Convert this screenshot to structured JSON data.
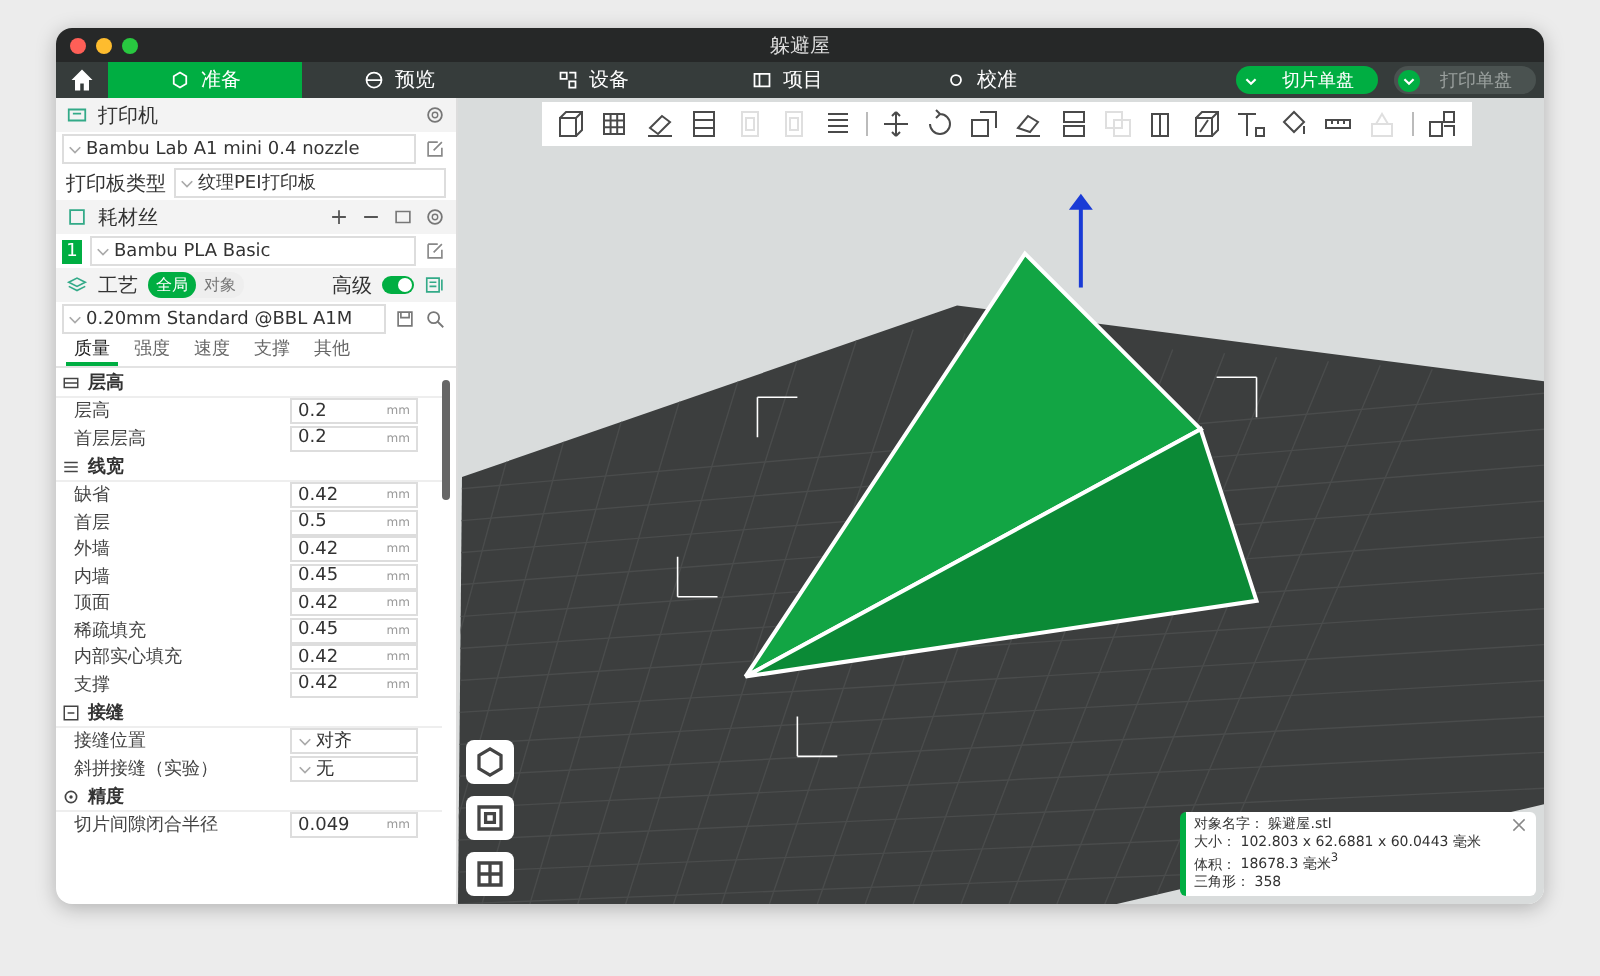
{
  "window": {
    "title": "躲避屋"
  },
  "tabs": [
    {
      "label": "准备",
      "selected": true,
      "kind": "prepare"
    },
    {
      "label": "预览",
      "selected": false,
      "kind": "preview"
    },
    {
      "label": "设备",
      "selected": false,
      "kind": "device"
    },
    {
      "label": "项目",
      "selected": false,
      "kind": "project"
    },
    {
      "label": "校准",
      "selected": false,
      "kind": "calibrate"
    }
  ],
  "actions": [
    {
      "label": "切片单盘",
      "disabled": false
    },
    {
      "label": "打印单盘",
      "disabled": true
    }
  ],
  "printer": {
    "title": "打印机",
    "model": "Bambu Lab A1 mini 0.4 nozzle",
    "plate_label": "打印板类型",
    "plate": "纹理PEI打印板"
  },
  "filament": {
    "title": "耗材丝",
    "items": [
      {
        "index": "1",
        "name": "Bambu PLA Basic",
        "color": "#00ae42"
      }
    ]
  },
  "process": {
    "title": "工艺",
    "scope": [
      {
        "label": "全局",
        "selected": true
      },
      {
        "label": "对象",
        "selected": false
      }
    ],
    "advanced_label": "高级",
    "advanced": true,
    "preset": "0.20mm Standard @BBL A1M",
    "subtabs": [
      {
        "label": "质量",
        "selected": true
      },
      {
        "label": "强度",
        "selected": false
      },
      {
        "label": "速度",
        "selected": false
      },
      {
        "label": "支撑",
        "selected": false
      },
      {
        "label": "其他",
        "selected": false
      }
    ],
    "sections": [
      {
        "title": "层高",
        "kind": "layers",
        "rows": [
          {
            "label": "层高",
            "value": "0.2",
            "unit": "mm",
            "kind": "number"
          },
          {
            "label": "首层层高",
            "value": "0.2",
            "unit": "mm",
            "kind": "number"
          }
        ]
      },
      {
        "title": "线宽",
        "kind": "width",
        "rows": [
          {
            "label": "缺省",
            "value": "0.42",
            "unit": "mm",
            "kind": "number"
          },
          {
            "label": "首层",
            "value": "0.5",
            "unit": "mm",
            "kind": "number"
          },
          {
            "label": "外墙",
            "value": "0.42",
            "unit": "mm",
            "kind": "number"
          },
          {
            "label": "内墙",
            "value": "0.45",
            "unit": "mm",
            "kind": "number"
          },
          {
            "label": "顶面",
            "value": "0.42",
            "unit": "mm",
            "kind": "number"
          },
          {
            "label": "稀疏填充",
            "value": "0.45",
            "unit": "mm",
            "kind": "number"
          },
          {
            "label": "内部实心填充",
            "value": "0.42",
            "unit": "mm",
            "kind": "number"
          },
          {
            "label": "支撑",
            "value": "0.42",
            "unit": "mm",
            "kind": "number"
          }
        ]
      },
      {
        "title": "接缝",
        "kind": "seam",
        "rows": [
          {
            "label": "接缝位置",
            "value": "对齐",
            "kind": "select"
          },
          {
            "label": "斜拼接缝（实验）",
            "value": "无",
            "kind": "select"
          }
        ]
      },
      {
        "title": "精度",
        "kind": "precision",
        "rows": [
          {
            "label": "切片间隙闭合半径",
            "value": "0.049",
            "unit": "mm",
            "kind": "number"
          }
        ]
      }
    ]
  },
  "toolbar": [
    {
      "kind": "cube",
      "disabled": false
    },
    {
      "kind": "grid",
      "disabled": false
    },
    {
      "kind": "arrange",
      "disabled": false
    },
    {
      "kind": "layout",
      "disabled": false
    },
    {
      "kind": "plate",
      "disabled": true
    },
    {
      "kind": "plate",
      "disabled": true
    },
    {
      "kind": "layers",
      "disabled": false
    },
    {
      "kind": "separator"
    },
    {
      "kind": "move",
      "disabled": false
    },
    {
      "kind": "rotate",
      "disabled": false
    },
    {
      "kind": "scale",
      "disabled": false
    },
    {
      "kind": "flat",
      "disabled": false
    },
    {
      "kind": "split",
      "disabled": false
    },
    {
      "kind": "boolean",
      "disabled": true
    },
    {
      "kind": "cut",
      "disabled": false
    },
    {
      "kind": "solid",
      "disabled": false
    },
    {
      "kind": "text",
      "disabled": false
    },
    {
      "kind": "paint",
      "disabled": false
    },
    {
      "kind": "measure",
      "disabled": false
    },
    {
      "kind": "assembly",
      "disabled": true
    },
    {
      "kind": "separator"
    },
    {
      "kind": "explode",
      "disabled": false
    }
  ],
  "object_info": [
    {
      "label": "对象名字：",
      "value": "躲避屋.stl"
    },
    {
      "label": "大小：",
      "value": "102.803 x 62.6881 x 60.0443 毫米"
    },
    {
      "label": "体积：",
      "value": "18678.3 毫米$^{3}$"
    },
    {
      "label": "三角形：",
      "value": "358"
    }
  ]
}
